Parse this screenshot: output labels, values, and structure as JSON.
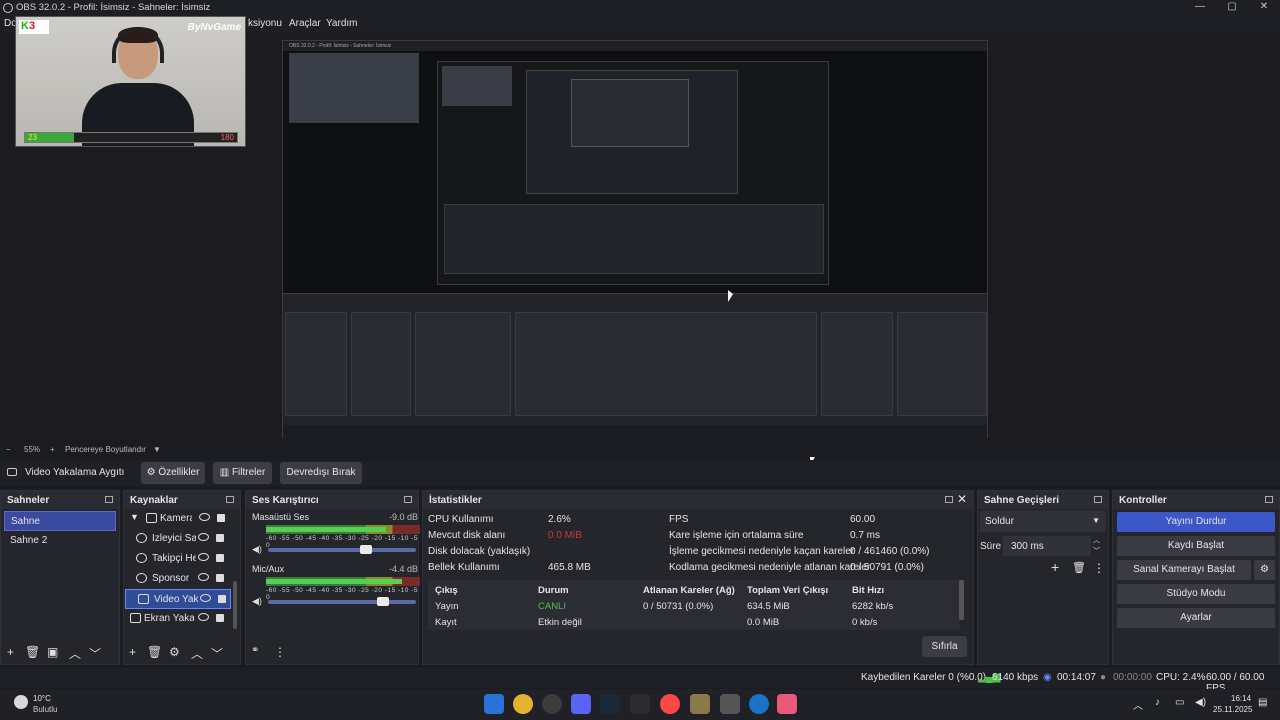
{
  "window": {
    "title": "OBS 32.0.2 - Profil: İsimsiz - Sahneler: İsimsiz",
    "minimize": "—",
    "maximize": "▢",
    "close": "✕"
  },
  "menu": [
    "Do",
    "ksiyonu",
    "Araçlar",
    "Yardım"
  ],
  "preview": {
    "webcam": {
      "logo_k": "K",
      "logo_3": "3",
      "brand": "ByNvGame",
      "bar_left": "23",
      "bar_right": "180",
      "bar_fill": 0.23
    },
    "nested_title": "OBS 32.0.2 - Profil: İsimsiz - Sahneler: İsimsiz"
  },
  "zoom": {
    "value": "55%",
    "mode": "Pencereye Boyutlandır"
  },
  "source_toolbar": {
    "source_name": "Video Yakalama Aygıtı",
    "properties": "Özellikler",
    "filters": "Filtreler",
    "deactivate": "Devredışı Bırak"
  },
  "scenes": {
    "title": "Sahneler",
    "items": [
      "Sahne",
      "Sahne 2"
    ],
    "selected": 0
  },
  "sources": {
    "title": "Kaynaklar",
    "items": [
      "Kamera",
      "İzleyici Sayısı",
      "Takipçi Hedefi",
      "Sponsor",
      "Video Yakalama Aygıtı",
      "Ekran Yakalama"
    ],
    "selected": 4
  },
  "mixer": {
    "title": "Ses Karıştırıcı",
    "scale": "-60 -55 -50 -45 -40 -35 -30 -25 -20 -15 -10 -5 0",
    "channels": [
      {
        "name": "Masaüstü Ses",
        "db": "-9.0 dB",
        "level": 0.78,
        "volume": 0.66
      },
      {
        "name": "Mic/Aux",
        "db": "-4.4 dB",
        "level": 0.88,
        "volume": 0.78
      }
    ]
  },
  "stats": {
    "title": "İstatistikler",
    "left": [
      {
        "label": "CPU Kullanımı",
        "value": "2.6%"
      },
      {
        "label": "Mevcut disk alanı",
        "value": "0.0 MiB"
      },
      {
        "label": "Disk dolacak (yaklaşık)",
        "value": ""
      },
      {
        "label": "Bellek Kullanımı",
        "value": "465.8 MB"
      }
    ],
    "right": [
      {
        "label": "FPS",
        "value": "60.00"
      },
      {
        "label": "Kare işleme için ortalama süre",
        "value": "0.7 ms"
      },
      {
        "label": "İşleme gecikmesi nedeniyle kaçan kareler",
        "value": "0 / 461460 (0.0%)"
      },
      {
        "label": "Kodlama gecikmesi nedeniyle atlanan kareler",
        "value": "0 / 50791 (0.0%)"
      }
    ],
    "table": {
      "headers": [
        "Çıkış",
        "Durum",
        "Atlanan Kareler (Ağ)",
        "Toplam Veri Çıkışı",
        "Bit Hızı"
      ],
      "rows": [
        [
          "Yayın",
          "CANLI",
          "0 / 50731 (0.0%)",
          "634.5 MiB",
          "6282 kb/s"
        ],
        [
          "Kayıt",
          "Etkin değil",
          "",
          "0.0 MiB",
          "0 kb/s"
        ]
      ]
    },
    "reset": "Sıfırla"
  },
  "transitions": {
    "title": "Sahne Geçişleri",
    "type": "Soldur",
    "duration_label": "Süre",
    "duration": "300 ms"
  },
  "controls": {
    "title": "Kontroller",
    "stop_stream": "Yayını Durdur",
    "start_record": "Kaydı Başlat",
    "virtual_cam": "Sanal Kamerayı Başlat",
    "studio": "Stüdyo Modu",
    "settings": "Ayarlar"
  },
  "status": {
    "dropped": "Kaybedilen Kareler 0 (%0.0)",
    "bitrate": "6140 kbps",
    "stream_time": "00:14:07",
    "rec_time": "00:00:00",
    "cpu": "CPU: 2.4%",
    "fps": "60.00 / 60.00 FPS"
  },
  "taskbar": {
    "temp": "10°C",
    "weather": "Bulutlu",
    "time": "16:14",
    "date": "25.11.2025"
  },
  "colors": {
    "accent": "#3b57c8",
    "live": "#4cc24c",
    "selection": "#2f4c99"
  }
}
